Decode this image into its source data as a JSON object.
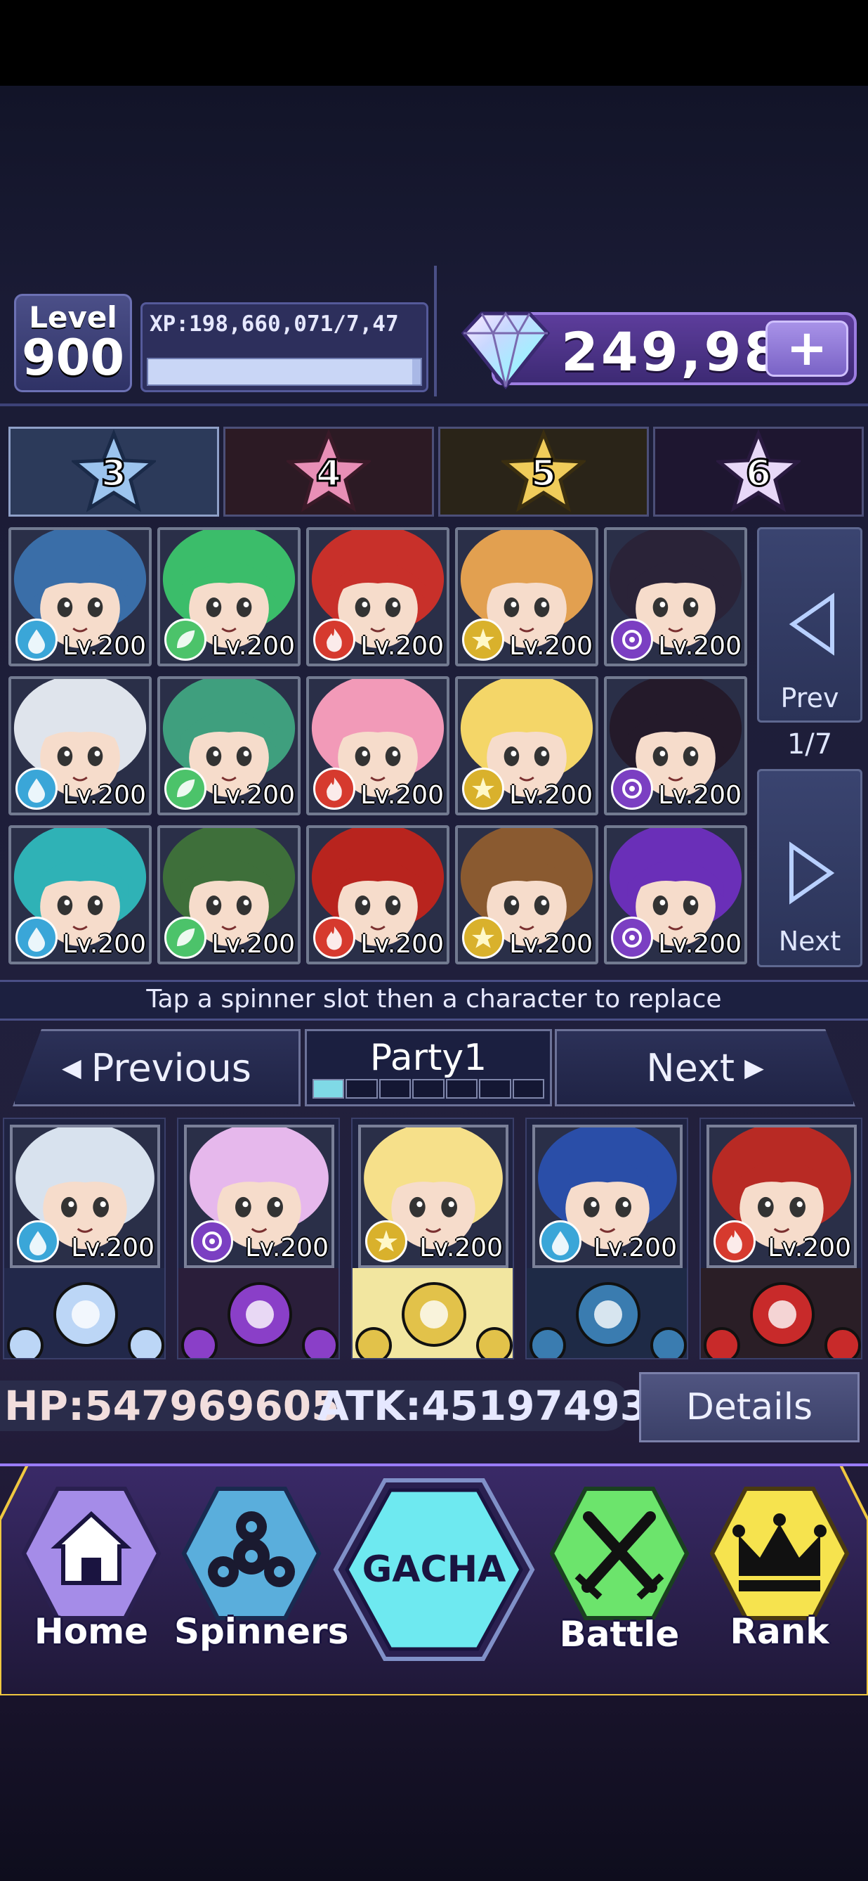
{
  "header": {
    "level_label": "Level",
    "level_value": "900",
    "xp_text": "XP:198,660,071/7,47",
    "xp_progress": 0.97,
    "gems": "249,98",
    "plus_label": "+"
  },
  "rarity_tabs": [
    "3",
    "4",
    "5",
    "6"
  ],
  "roster": {
    "level_label": "Lv.200",
    "prev_label": "Prev",
    "next_label": "Next",
    "page_indicator": "1/7",
    "elements": [
      "water",
      "leaf",
      "fire",
      "light",
      "dark"
    ]
  },
  "hint": "Tap a spinner slot then a character to replace",
  "party": {
    "prev_label": "Previous",
    "next_label": "Next",
    "name": "Party1",
    "active_page": 1,
    "total_pages": 7,
    "level_label": "Lv.200"
  },
  "stats": {
    "hp": "HP:547969605",
    "atk": "ATK:45197493",
    "details_label": "Details"
  },
  "nav": {
    "home": "Home",
    "spinners": "Spinners",
    "gacha": "GACHA",
    "battle": "Battle",
    "rank": "Rank"
  },
  "colors": {
    "water": "#3aa6d8",
    "leaf": "#4cc36a",
    "fire": "#d63a2e",
    "light": "#d9b12c",
    "dark": "#7b3fc2",
    "gacha": "#6ee9f0"
  }
}
